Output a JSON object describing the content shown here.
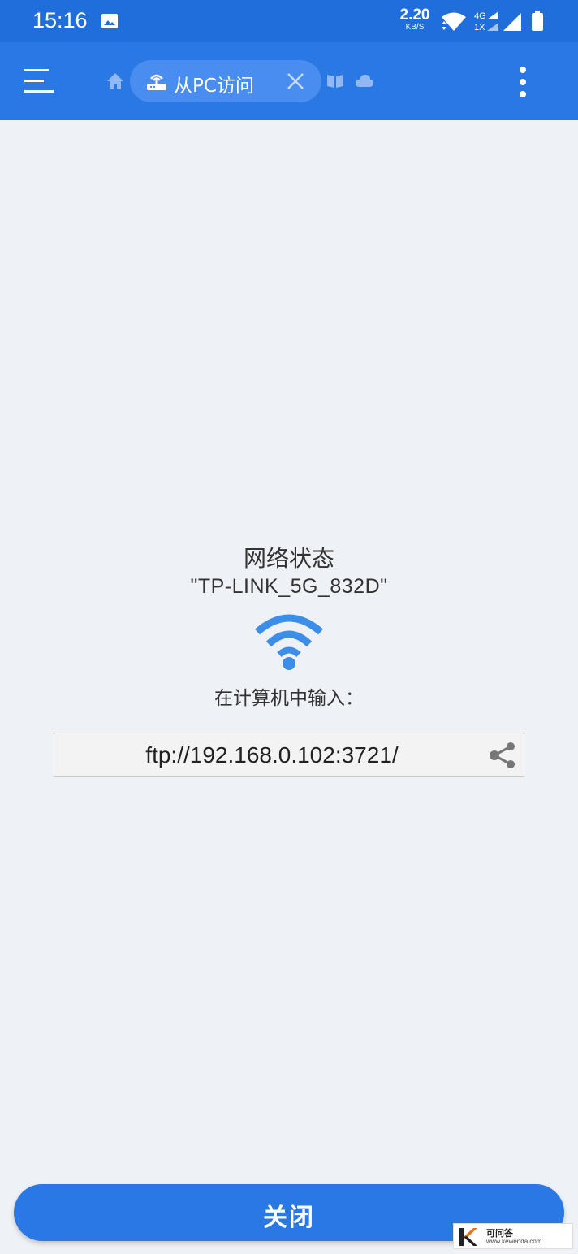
{
  "status_bar": {
    "time": "15:16",
    "net_speed_value": "2.20",
    "net_speed_unit": "KB/S",
    "network_gen_top": "4G",
    "network_gen_bottom": "1X"
  },
  "toolbar": {
    "tab_label": "从PC访问"
  },
  "content": {
    "title": "网络状态",
    "ssid": "\"TP-LINK_5G_832D\"",
    "input_hint": "在计算机中输入：",
    "url": "ftp://192.168.0.102:3721/"
  },
  "footer": {
    "close_label": "关闭"
  },
  "watermark": {
    "name": "可问答",
    "url": "www.kewenda.com"
  },
  "colors": {
    "status_bar": "#1f6edc",
    "toolbar": "#2a78e4",
    "tab_pill": "#4a8df0",
    "accent_wifi": "#3d8ee8",
    "background": "#eef1f5"
  }
}
